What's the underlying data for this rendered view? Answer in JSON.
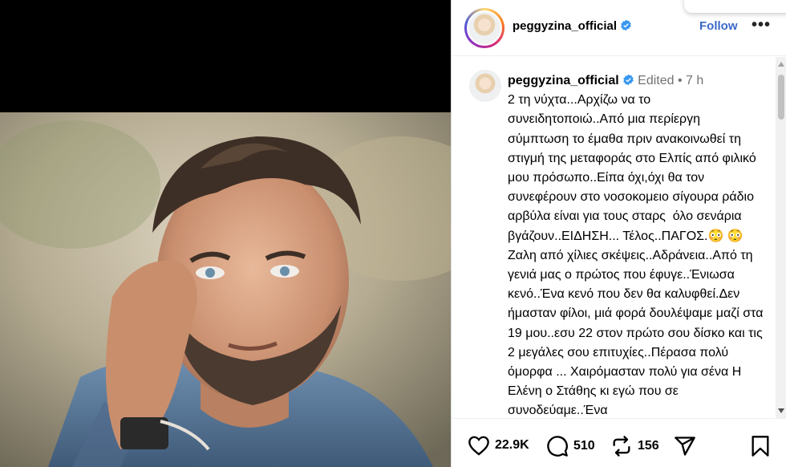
{
  "post": {
    "username": "peggyzina_official",
    "verified": true,
    "follow_label": "Follow",
    "more_label": "•••"
  },
  "caption": {
    "username": "peggyzina_official",
    "edited_label": "Edited",
    "separator": "•",
    "time_ago": "7 h",
    "text": "2 τη νύχτα...Αρχίζω να το συνειδητοποιώ..Από μια περίεργη σύμπτωση το έμαθα πριν ανακοινωθεί τη στιγμή της μεταφοράς στο Ελπίς από φιλικό μου πρόσωπο..Είπα όχι,όχι θα τον συνεφέρουν στο νοσοκομειο σίγουρα ράδιο αρβύλα είναι για τους σταρς  όλο σενάρια βγάζουν..ΕΙΔΗΣΗ... Τέλος..ΠΑΓΟΣ.😳 😳 Ζαλη από χίλιες σκέψεις..Αδράνεια..Από τη γενιά μας ο πρώτος που έφυγε..Ένιωσα κενό..Ένα κενό που δεν θα καλυφθεί.Δεν ήμασταν φίλοι, μιά φορά δουλέψαμε μαζί στα 19 μου..εσυ 22 στον πρώτο σου δίσκο και τις 2 μεγάλες σου επιτυχίες..Πέρασα πολύ όμορφα ... Χαιρόμασταν πολύ για σένα Η Ελένη ο Στάθης κι εγώ που σε συνοδεύαμε..Ένα"
  },
  "actions": {
    "likes": "22.9K",
    "comments": "510",
    "reposts": "156"
  },
  "colors": {
    "follow": "#3a68c8",
    "verified": "#3897f0",
    "meta": "#737373"
  },
  "icons": [
    "verified-badge-icon",
    "more-options-icon",
    "heart-icon",
    "comment-icon",
    "repost-icon",
    "share-icon",
    "bookmark-icon",
    "scroll-up-icon",
    "scroll-down-icon"
  ]
}
